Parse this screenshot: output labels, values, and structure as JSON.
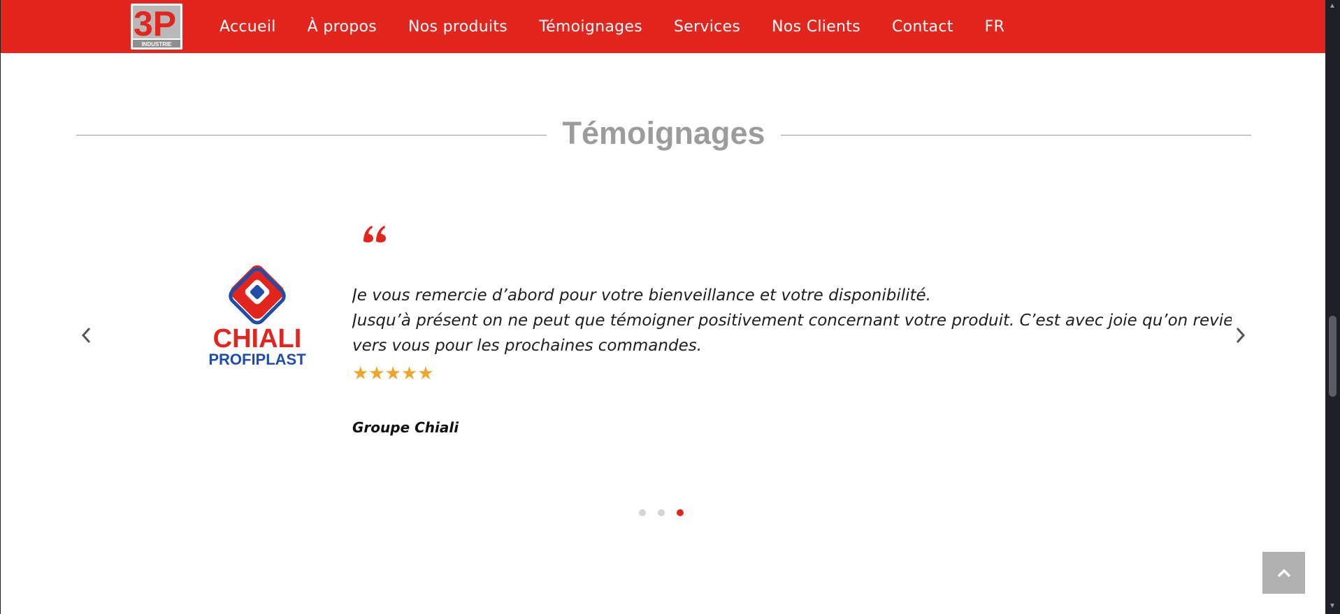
{
  "brand": {
    "logo_text": "3P",
    "logo_subtext": "INDUSTRIE",
    "primary_color": "#e2251d"
  },
  "nav": {
    "items": [
      {
        "label": "Accueil"
      },
      {
        "label": "À propos"
      },
      {
        "label": "Nos produits"
      },
      {
        "label": "Témoignages"
      },
      {
        "label": "Services"
      },
      {
        "label": "Nos Clients"
      },
      {
        "label": "Contact"
      },
      {
        "label": "FR"
      }
    ]
  },
  "section": {
    "title": "Témoignages"
  },
  "testimonial": {
    "client_logo": {
      "line1": "CHIALI",
      "line2": "PROFIPLAST"
    },
    "quote_icon": "quote-icon",
    "lines": [
      "Je vous remercie d’abord pour votre bienveillance et votre disponibilité.",
      "Jusqu’à présent on ne peut que témoigner positivement concernant votre produit. C’est avec joie qu’on reviendra",
      "vers vous pour les prochaines commandes."
    ],
    "stars": "★★★★★",
    "rating": 5,
    "author": "Groupe Chiali"
  },
  "carousel": {
    "slide_count": 3,
    "active_slide": 3
  },
  "icons": {
    "prev": "chevron-left-icon",
    "next": "chevron-right-icon",
    "back_to_top": "chevron-up-icon"
  }
}
